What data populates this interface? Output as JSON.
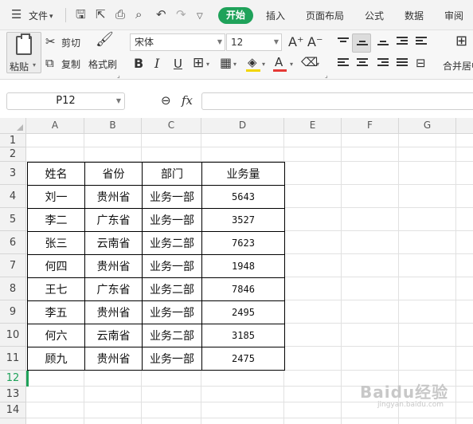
{
  "menu": {
    "file_label": "文件",
    "tabs": [
      "开始",
      "插入",
      "页面布局",
      "公式",
      "数据",
      "审阅"
    ],
    "active_tab": "开始"
  },
  "ribbon": {
    "paste_label": "粘贴",
    "cut_label": "剪切",
    "copy_label": "复制",
    "format_painter_label": "格式刷",
    "font_name": "宋体",
    "font_size": "12",
    "merge_label": "合并居中"
  },
  "formula_bar": {
    "name_box": "P12",
    "fx_label": "fx",
    "formula": ""
  },
  "grid": {
    "columns": [
      "A",
      "B",
      "C",
      "D",
      "E",
      "F",
      "G"
    ],
    "rows": [
      "1",
      "2",
      "3",
      "4",
      "5",
      "6",
      "7",
      "8",
      "9",
      "10",
      "11",
      "12",
      "13",
      "14"
    ],
    "selected_row": "12"
  },
  "table": {
    "headers": [
      "姓名",
      "省份",
      "部门",
      "业务量"
    ],
    "rows": [
      [
        "刘一",
        "贵州省",
        "业务一部",
        "5643"
      ],
      [
        "李二",
        "广东省",
        "业务一部",
        "3527"
      ],
      [
        "张三",
        "云南省",
        "业务二部",
        "7623"
      ],
      [
        "何四",
        "贵州省",
        "业务一部",
        "1948"
      ],
      [
        "王七",
        "广东省",
        "业务二部",
        "7846"
      ],
      [
        "李五",
        "贵州省",
        "业务一部",
        "2495"
      ],
      [
        "何六",
        "云南省",
        "业务二部",
        "3185"
      ],
      [
        "顾九",
        "贵州省",
        "业务一部",
        "2475"
      ]
    ]
  },
  "watermark": {
    "text": "Baidu经验",
    "sub": "jingyan.baidu.com"
  },
  "colors": {
    "accent": "#1fa25a",
    "border": "#000000",
    "gridline": "#e1e1e1"
  }
}
